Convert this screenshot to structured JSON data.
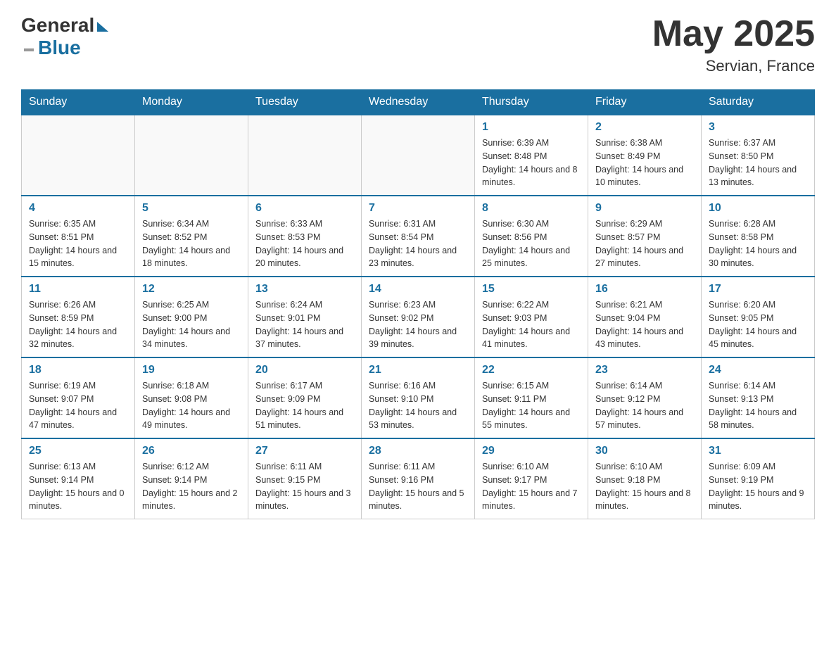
{
  "header": {
    "logo": {
      "general": "General",
      "blue": "Blue"
    },
    "title": "May 2025",
    "location": "Servian, France"
  },
  "days_of_week": [
    "Sunday",
    "Monday",
    "Tuesday",
    "Wednesday",
    "Thursday",
    "Friday",
    "Saturday"
  ],
  "weeks": [
    [
      {
        "day": "",
        "info": ""
      },
      {
        "day": "",
        "info": ""
      },
      {
        "day": "",
        "info": ""
      },
      {
        "day": "",
        "info": ""
      },
      {
        "day": "1",
        "info": "Sunrise: 6:39 AM\nSunset: 8:48 PM\nDaylight: 14 hours and 8 minutes."
      },
      {
        "day": "2",
        "info": "Sunrise: 6:38 AM\nSunset: 8:49 PM\nDaylight: 14 hours and 10 minutes."
      },
      {
        "day": "3",
        "info": "Sunrise: 6:37 AM\nSunset: 8:50 PM\nDaylight: 14 hours and 13 minutes."
      }
    ],
    [
      {
        "day": "4",
        "info": "Sunrise: 6:35 AM\nSunset: 8:51 PM\nDaylight: 14 hours and 15 minutes."
      },
      {
        "day": "5",
        "info": "Sunrise: 6:34 AM\nSunset: 8:52 PM\nDaylight: 14 hours and 18 minutes."
      },
      {
        "day": "6",
        "info": "Sunrise: 6:33 AM\nSunset: 8:53 PM\nDaylight: 14 hours and 20 minutes."
      },
      {
        "day": "7",
        "info": "Sunrise: 6:31 AM\nSunset: 8:54 PM\nDaylight: 14 hours and 23 minutes."
      },
      {
        "day": "8",
        "info": "Sunrise: 6:30 AM\nSunset: 8:56 PM\nDaylight: 14 hours and 25 minutes."
      },
      {
        "day": "9",
        "info": "Sunrise: 6:29 AM\nSunset: 8:57 PM\nDaylight: 14 hours and 27 minutes."
      },
      {
        "day": "10",
        "info": "Sunrise: 6:28 AM\nSunset: 8:58 PM\nDaylight: 14 hours and 30 minutes."
      }
    ],
    [
      {
        "day": "11",
        "info": "Sunrise: 6:26 AM\nSunset: 8:59 PM\nDaylight: 14 hours and 32 minutes."
      },
      {
        "day": "12",
        "info": "Sunrise: 6:25 AM\nSunset: 9:00 PM\nDaylight: 14 hours and 34 minutes."
      },
      {
        "day": "13",
        "info": "Sunrise: 6:24 AM\nSunset: 9:01 PM\nDaylight: 14 hours and 37 minutes."
      },
      {
        "day": "14",
        "info": "Sunrise: 6:23 AM\nSunset: 9:02 PM\nDaylight: 14 hours and 39 minutes."
      },
      {
        "day": "15",
        "info": "Sunrise: 6:22 AM\nSunset: 9:03 PM\nDaylight: 14 hours and 41 minutes."
      },
      {
        "day": "16",
        "info": "Sunrise: 6:21 AM\nSunset: 9:04 PM\nDaylight: 14 hours and 43 minutes."
      },
      {
        "day": "17",
        "info": "Sunrise: 6:20 AM\nSunset: 9:05 PM\nDaylight: 14 hours and 45 minutes."
      }
    ],
    [
      {
        "day": "18",
        "info": "Sunrise: 6:19 AM\nSunset: 9:07 PM\nDaylight: 14 hours and 47 minutes."
      },
      {
        "day": "19",
        "info": "Sunrise: 6:18 AM\nSunset: 9:08 PM\nDaylight: 14 hours and 49 minutes."
      },
      {
        "day": "20",
        "info": "Sunrise: 6:17 AM\nSunset: 9:09 PM\nDaylight: 14 hours and 51 minutes."
      },
      {
        "day": "21",
        "info": "Sunrise: 6:16 AM\nSunset: 9:10 PM\nDaylight: 14 hours and 53 minutes."
      },
      {
        "day": "22",
        "info": "Sunrise: 6:15 AM\nSunset: 9:11 PM\nDaylight: 14 hours and 55 minutes."
      },
      {
        "day": "23",
        "info": "Sunrise: 6:14 AM\nSunset: 9:12 PM\nDaylight: 14 hours and 57 minutes."
      },
      {
        "day": "24",
        "info": "Sunrise: 6:14 AM\nSunset: 9:13 PM\nDaylight: 14 hours and 58 minutes."
      }
    ],
    [
      {
        "day": "25",
        "info": "Sunrise: 6:13 AM\nSunset: 9:14 PM\nDaylight: 15 hours and 0 minutes."
      },
      {
        "day": "26",
        "info": "Sunrise: 6:12 AM\nSunset: 9:14 PM\nDaylight: 15 hours and 2 minutes."
      },
      {
        "day": "27",
        "info": "Sunrise: 6:11 AM\nSunset: 9:15 PM\nDaylight: 15 hours and 3 minutes."
      },
      {
        "day": "28",
        "info": "Sunrise: 6:11 AM\nSunset: 9:16 PM\nDaylight: 15 hours and 5 minutes."
      },
      {
        "day": "29",
        "info": "Sunrise: 6:10 AM\nSunset: 9:17 PM\nDaylight: 15 hours and 7 minutes."
      },
      {
        "day": "30",
        "info": "Sunrise: 6:10 AM\nSunset: 9:18 PM\nDaylight: 15 hours and 8 minutes."
      },
      {
        "day": "31",
        "info": "Sunrise: 6:09 AM\nSunset: 9:19 PM\nDaylight: 15 hours and 9 minutes."
      }
    ]
  ]
}
